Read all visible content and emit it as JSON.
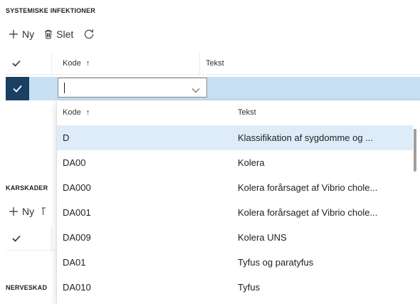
{
  "sections": {
    "systemiske": {
      "title": "SYSTEMISKE INFEKTIONER"
    },
    "karskader": {
      "title_visible": "KARSKADER"
    },
    "nerveskad": {
      "title_visible": "NERVESKAD"
    }
  },
  "toolbar": {
    "new_label": "Ny",
    "delete_label": "Slet"
  },
  "toolbar2": {
    "new_label": "Ny"
  },
  "grid": {
    "col_code": "Kode",
    "col_text": "Tekst",
    "sort_arrow": "↑"
  },
  "input": {
    "value": ""
  },
  "dropdown": {
    "col_code": "Kode",
    "col_text": "Tekst",
    "sort_arrow": "↑",
    "rows": [
      {
        "code": "D",
        "text": "Klassifikation af sygdomme og ..."
      },
      {
        "code": "DA00",
        "text": "Kolera"
      },
      {
        "code": "DA000",
        "text": "Kolera forårsaget af Vibrio chole..."
      },
      {
        "code": "DA001",
        "text": "Kolera forårsaget af Vibrio chole..."
      },
      {
        "code": "DA009",
        "text": "Kolera UNS"
      },
      {
        "code": "DA01",
        "text": "Tyfus og paratyfus"
      },
      {
        "code": "DA010",
        "text": "Tyfus"
      }
    ]
  },
  "colors": {
    "selected_row": "#c7e0f4",
    "check_filled": "#1b3f63",
    "dropdown_active": "#deecf9"
  }
}
